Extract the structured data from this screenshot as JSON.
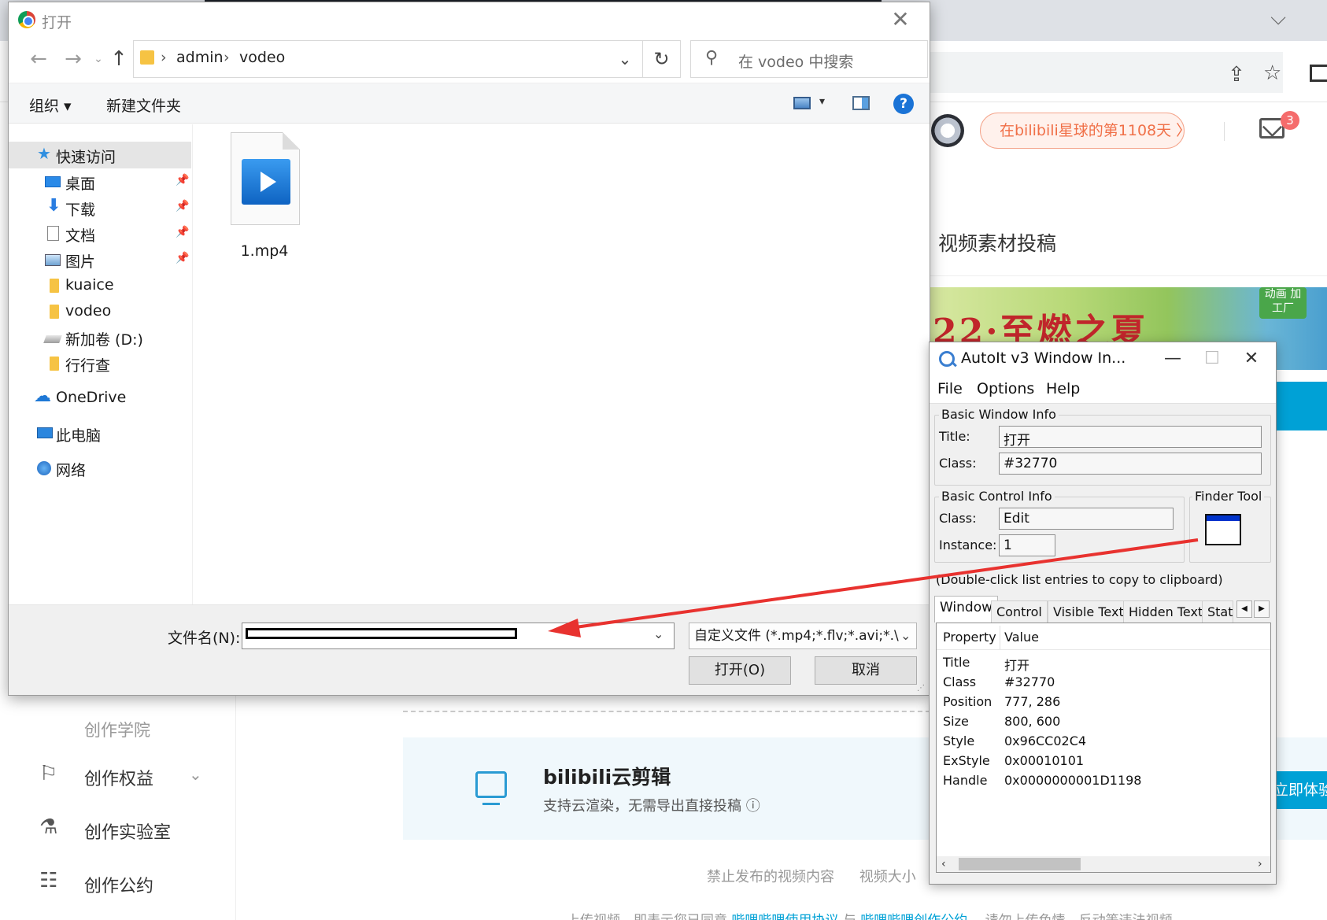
{
  "browser": {
    "planet_pill": "在bilibili星球的第1108天 〉",
    "mail_badge": "3",
    "page_title": "视频素材投稿",
    "banner_text": "22·至燃之夏",
    "banner_tag": "动画 加工厂",
    "sidebar": {
      "sub_item": "创作学院",
      "items": [
        {
          "label": "创作权益",
          "icon": "flag-icon"
        },
        {
          "label": "创作实验室",
          "icon": "flask-icon"
        },
        {
          "label": "创作公约",
          "icon": "contract-icon"
        }
      ]
    },
    "cloud_card": {
      "title": "bilibili云剪辑",
      "subtitle": "支持云渲染，无需导出直接投稿 ⓘ",
      "button": "立即体验"
    },
    "footer_links": [
      "禁止发布的视频内容",
      "视频大小"
    ],
    "footer_agree": {
      "prefix": "上传视频，即表示您已同意",
      "link1": "哔哩哔哩使用协议",
      "and": "与",
      "link2": "哔哩哔哩创作公约",
      "suffix": "，请勿上传色情，反动等违法视频"
    }
  },
  "dialog": {
    "title": "打开",
    "breadcrumb": [
      "admin",
      "vodeo"
    ],
    "search_placeholder": "在 vodeo 中搜索",
    "toolbar": {
      "organize": "组织 ▾",
      "new_folder": "新建文件夹",
      "help": "?"
    },
    "nav": [
      {
        "label": "快速访问",
        "icon": "star-icon",
        "pinned": false,
        "selected": true
      },
      {
        "label": "桌面",
        "icon": "desktop-icon",
        "pinned": true
      },
      {
        "label": "下载",
        "icon": "download-icon",
        "pinned": true
      },
      {
        "label": "文档",
        "icon": "document-icon",
        "pinned": true
      },
      {
        "label": "图片",
        "icon": "pictures-icon",
        "pinned": true
      },
      {
        "label": "kuaice",
        "icon": "folder-icon",
        "pinned": false
      },
      {
        "label": "vodeo",
        "icon": "folder-icon",
        "pinned": false
      },
      {
        "label": "新加卷 (D:)",
        "icon": "drive-icon",
        "pinned": false
      },
      {
        "label": "行行查",
        "icon": "folder-icon",
        "pinned": false
      },
      {
        "label": "OneDrive",
        "icon": "cloud-icon",
        "pinned": false
      },
      {
        "label": "此电脑",
        "icon": "computer-icon",
        "pinned": false
      },
      {
        "label": "网络",
        "icon": "network-icon",
        "pinned": false
      }
    ],
    "files": [
      {
        "name": "1.mp4",
        "icon": "video-file-icon"
      }
    ],
    "filename_label": "文件名(N):",
    "filename_value": "",
    "filetype_value": "自定义文件 (*.mp4;*.flv;*.avi;*.\\",
    "open_button": "打开(O)",
    "cancel_button": "取消"
  },
  "autoit": {
    "title": "AutoIt v3 Window In...",
    "menu": [
      "File",
      "Options",
      "Help"
    ],
    "basic_window_info": "Basic Window Info",
    "title_label": "Title:",
    "title_value": "打开",
    "class_label": "Class:",
    "class_value": "#32770",
    "basic_control_info": "Basic Control Info",
    "control_class_label": "Class:",
    "control_class_value": "Edit",
    "instance_label": "Instance:",
    "instance_value": "1",
    "finder_tool": "Finder Tool",
    "hint": "(Double-click list entries to copy to clipboard)",
    "tabs": [
      "Window",
      "Control",
      "Visible Text",
      "Hidden Text",
      "Stat"
    ],
    "list_headers": [
      "Property",
      "Value"
    ],
    "properties": [
      {
        "name": "Title",
        "value": "打开"
      },
      {
        "name": "Class",
        "value": "#32770"
      },
      {
        "name": "Position",
        "value": "777, 286"
      },
      {
        "name": "Size",
        "value": "800, 600"
      },
      {
        "name": "Style",
        "value": "0x96CC02C4"
      },
      {
        "name": "ExStyle",
        "value": "0x00010101"
      },
      {
        "name": "Handle",
        "value": "0x0000000001D1198"
      }
    ]
  }
}
